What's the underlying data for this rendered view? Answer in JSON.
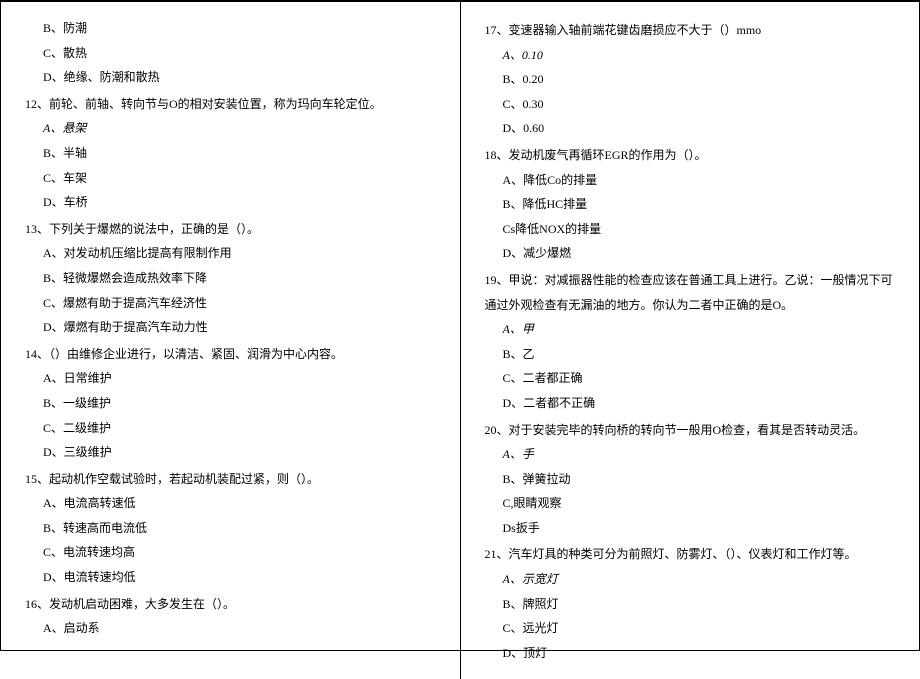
{
  "left": {
    "pre_opts": [
      "B、防潮",
      "C、散热",
      "D、绝缘、防潮和散热"
    ],
    "q12": "12、前轮、前轴、转向节与O的相对安装位置，称为玛向车轮定位。",
    "q12_opts": [
      "A、悬架",
      "B、半轴",
      "C、车架",
      "D、车桥"
    ],
    "q13": "13、下列关于爆燃的说法中，正确的是（）。",
    "q13_opts": [
      "A、对发动机压缩比提高有限制作用",
      "B、轻微爆燃会造成热效率下降",
      "C、爆燃有助于提高汽车经济性",
      "D、爆燃有助于提高汽车动力性"
    ],
    "q14": "14、（）由维修企业进行，以清洁、紧固、润滑为中心内容。",
    "q14_opts": [
      "A、日常维护",
      "B、一级维护",
      "C、二级维护",
      "D、三级维护"
    ],
    "q15": "15、起动机作空载试验时，若起动机装配过紧，则（）。",
    "q15_opts": [
      "A、电流高转速低",
      "B、转速高而电流低",
      "C、电流转速均高",
      "D、电流转速均低"
    ],
    "q16": "16、发动机启动困难，大多发生在（）。",
    "q16_opts": [
      "A、启动系"
    ]
  },
  "right": {
    "q17": "17、变速器输入轴前端花键齿磨损应不大于（）mmo",
    "q17_opts": [
      "A、0.10",
      "B、0.20",
      "C、0.30",
      "D、0.60"
    ],
    "q18": "18、发动机废气再循环EGR的作用为（）。",
    "q18_opts": [
      "A、降低Co的排量",
      "B、降低HC排量",
      "Cs降低NOX的排量",
      "D、减少爆燃"
    ],
    "q19": "19、甲说：对减振器性能的检查应该在普通工具上进行。乙说：一般情况下可通过外观检查有无漏油的地方。你认为二者中正确的是O。",
    "q19_opts": [
      "A、甲",
      "B、乙",
      "C、二者都正确",
      "D、二者都不正确"
    ],
    "q20": "20、对于安装完毕的转向桥的转向节一般用O检查，看其是否转动灵活。",
    "q20_opts": [
      "A、手",
      "B、弹簧拉动",
      "C,眼睛观察",
      "Ds扳手"
    ],
    "q21": "21、汽车灯具的种类可分为前照灯、防雾灯、（）、仪表灯和工作灯等。",
    "q21_opts": [
      "A、示宽灯",
      "B、牌照灯",
      "C、远光灯",
      "D、顶灯"
    ]
  }
}
